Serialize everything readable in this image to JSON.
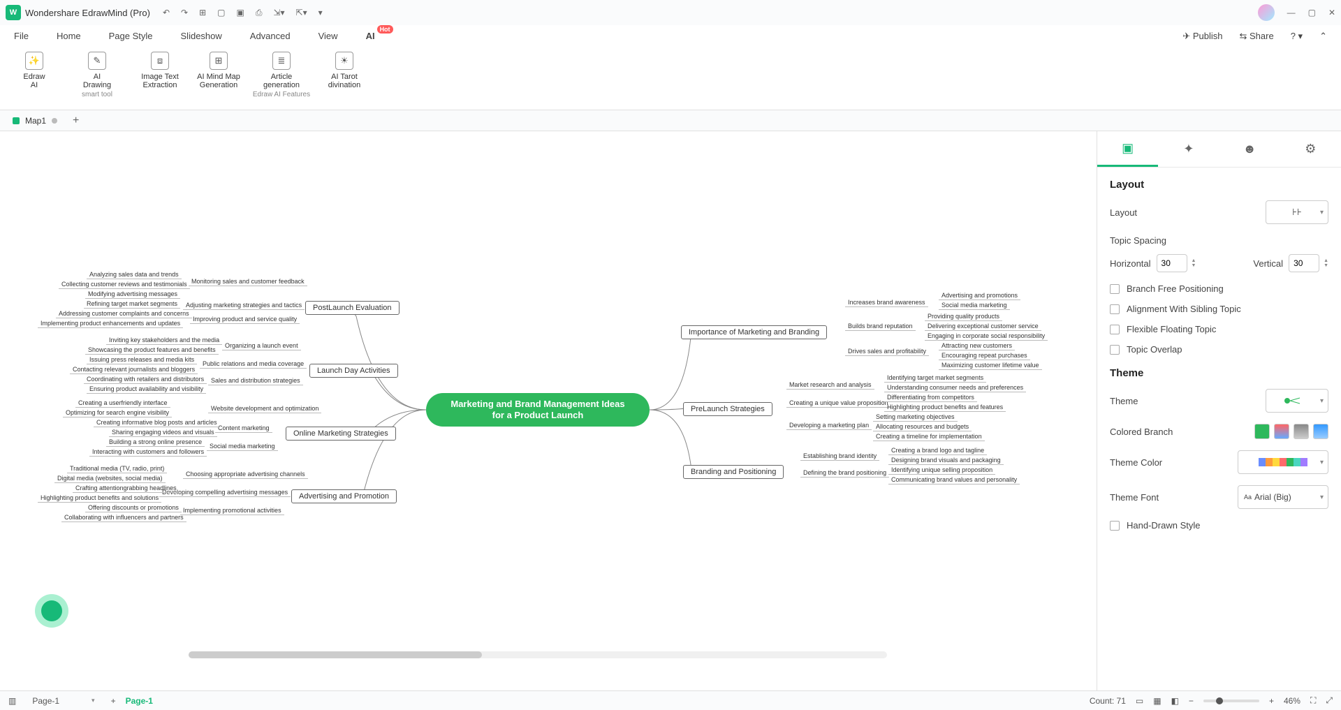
{
  "app": {
    "title": "Wondershare EdrawMind (Pro)"
  },
  "menu": {
    "file": "File",
    "home": "Home",
    "pageStyle": "Page Style",
    "slideshow": "Slideshow",
    "advanced": "Advanced",
    "view": "View",
    "ai": "AI",
    "hot": "Hot",
    "publish": "Publish",
    "share": "Share"
  },
  "ribbon": {
    "btns": [
      {
        "l1": "Edraw",
        "l2": "AI"
      },
      {
        "l1": "AI",
        "l2": "Drawing"
      },
      {
        "l1": "Image Text",
        "l2": "Extraction"
      },
      {
        "l1": "AI Mind Map",
        "l2": "Generation"
      },
      {
        "l1": "Article",
        "l2": "generation"
      },
      {
        "l1": "AI Tarot",
        "l2": "divination"
      }
    ],
    "group1": "smart tool",
    "group2": "Edraw AI Features"
  },
  "doc": {
    "tab": "Map1"
  },
  "map": {
    "center1": "Marketing and Brand Management Ideas",
    "center2": "for a Product Launch",
    "leftBranches": [
      "PostLaunch Evaluation",
      "Launch Day Activities",
      "Online Marketing Strategies",
      "Advertising and Promotion"
    ],
    "rightBranches": [
      "Importance of Marketing and Branding",
      "PreLaunch Strategies",
      "Branding and Positioning"
    ],
    "l0_sub": [
      "Monitoring sales and customer feedback",
      "Adjusting marketing strategies and tactics",
      "Improving product and service quality"
    ],
    "l0_leaf": [
      "Analyzing sales data and trends",
      "Collecting customer reviews and testimonials",
      "Modifying advertising messages",
      "Refining target market segments",
      "Addressing customer complaints and concerns",
      "Implementing product enhancements and updates"
    ],
    "l1_sub": [
      "Organizing a launch event",
      "Public relations and media coverage",
      "Sales and distribution strategies"
    ],
    "l1_leaf": [
      "Inviting key stakeholders and the media",
      "Showcasing the product features and benefits",
      "Issuing press releases and media kits",
      "Contacting relevant journalists and bloggers",
      "Coordinating with retailers and distributors",
      "Ensuring product availability and visibility"
    ],
    "l2_sub": [
      "Website development and optimization",
      "Content marketing",
      "Social media marketing"
    ],
    "l2_leaf": [
      "Creating a userfriendly interface",
      "Optimizing for search engine visibility",
      "Creating informative blog posts and articles",
      "Sharing engaging videos and visuals",
      "Building a strong online presence",
      "Interacting with customers and followers"
    ],
    "l3_sub": [
      "Choosing appropriate advertising channels",
      "Developing compelling advertising messages",
      "Implementing promotional activities"
    ],
    "l3_leaf": [
      "Traditional media (TV, radio, print)",
      "Digital media (websites, social media)",
      "Crafting attentiongrabbing headlines",
      "Highlighting product benefits and solutions",
      "Offering discounts or promotions",
      "Collaborating with influencers and partners"
    ],
    "r0_sub": [
      "Increases brand awareness",
      "Builds brand reputation",
      "Drives sales and profitability"
    ],
    "r0_leaf": [
      "Advertising and promotions",
      "Social media marketing",
      "Providing quality products",
      "Delivering exceptional customer service",
      "Engaging in corporate social responsibility",
      "Attracting new customers",
      "Encouraging repeat purchases",
      "Maximizing customer lifetime value"
    ],
    "r1_sub": [
      "Market research and analysis",
      "Creating a unique value proposition",
      "Developing a marketing plan"
    ],
    "r1_leaf": [
      "Identifying target market segments",
      "Understanding consumer needs and preferences",
      "Differentiating from competitors",
      "Highlighting product benefits and features",
      "Setting marketing objectives",
      "Allocating resources and budgets",
      "Creating a timeline for implementation"
    ],
    "r2_sub": [
      "Establishing brand identity",
      "Defining the brand positioning"
    ],
    "r2_leaf": [
      "Creating a brand logo and tagline",
      "Designing brand visuals and packaging",
      "Identifying unique selling proposition",
      "Communicating brand values and personality"
    ]
  },
  "side": {
    "layoutTitle": "Layout",
    "layoutLbl": "Layout",
    "spacingTitle": "Topic Spacing",
    "horiz": "Horizontal",
    "horizVal": "30",
    "vert": "Vertical",
    "vertVal": "30",
    "chk1": "Branch Free Positioning",
    "chk2": "Alignment With Sibling Topic",
    "chk3": "Flexible Floating Topic",
    "chk4": "Topic Overlap",
    "themeTitle": "Theme",
    "themeLbl": "Theme",
    "coloredBranch": "Colored Branch",
    "themeColor": "Theme Color",
    "themeFont": "Theme Font",
    "themeFontVal": "Arial (Big)",
    "hand": "Hand-Drawn Style"
  },
  "status": {
    "pageSel": "Page-1",
    "pageActive": "Page-1",
    "count": "Count: 71",
    "zoom": "46%"
  }
}
